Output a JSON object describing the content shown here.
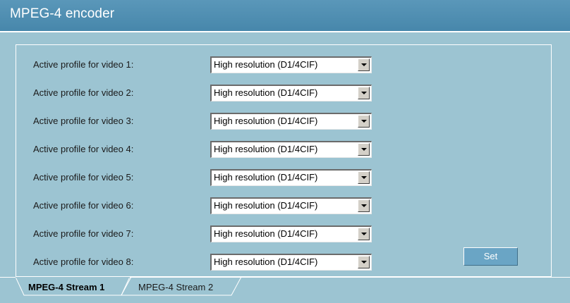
{
  "header": {
    "title": "MPEG-4 encoder"
  },
  "rows": [
    {
      "label": "Active profile for video 1:",
      "value": "High resolution (D1/4CIF)"
    },
    {
      "label": "Active profile for video 2:",
      "value": "High resolution (D1/4CIF)"
    },
    {
      "label": "Active profile for video 3:",
      "value": "High resolution (D1/4CIF)"
    },
    {
      "label": "Active profile for video 4:",
      "value": "High resolution (D1/4CIF)"
    },
    {
      "label": "Active profile for video 5:",
      "value": "High resolution (D1/4CIF)"
    },
    {
      "label": "Active profile for video 6:",
      "value": "High resolution (D1/4CIF)"
    },
    {
      "label": "Active profile for video 7:",
      "value": "High resolution (D1/4CIF)"
    },
    {
      "label": "Active profile for video 8:",
      "value": "High resolution (D1/4CIF)"
    }
  ],
  "set_button": {
    "label": "Set"
  },
  "tabs": [
    {
      "label": "MPEG-4 Stream 1",
      "active": true
    },
    {
      "label": "MPEG-4 Stream 2",
      "active": false
    }
  ],
  "colors": {
    "header": "#4f8fb2",
    "panel": "#9cc4d2",
    "button": "#6aa5c5"
  },
  "icons": {
    "dropdown": "chevron-down-icon"
  }
}
